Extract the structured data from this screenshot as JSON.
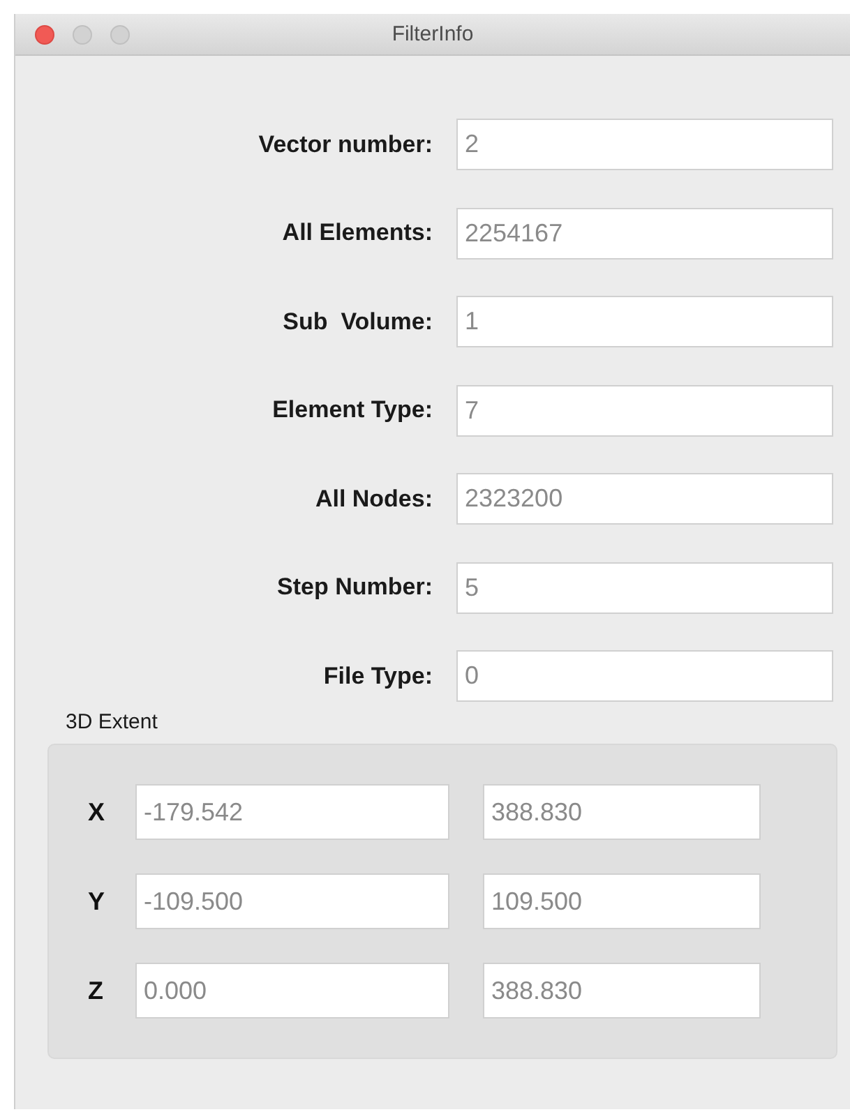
{
  "window": {
    "title": "FilterInfo"
  },
  "fields": [
    {
      "label": "Vector number:",
      "value": "2"
    },
    {
      "label": "All Elements:",
      "value": "2254167"
    },
    {
      "label": "Sub  Volume:",
      "value": "1"
    },
    {
      "label": "Element Type:",
      "value": "7"
    },
    {
      "label": "All Nodes:",
      "value": "2323200"
    },
    {
      "label": "Step Number:",
      "value": "5"
    },
    {
      "label": "File Type:",
      "value": "0"
    }
  ],
  "extent": {
    "title": "3D Extent",
    "axes": [
      {
        "label": "X",
        "min": "-179.542",
        "max": "388.830"
      },
      {
        "label": "Y",
        "min": "-109.500",
        "max": "109.500"
      },
      {
        "label": "Z",
        "min": "0.000",
        "max": "388.830"
      }
    ]
  }
}
